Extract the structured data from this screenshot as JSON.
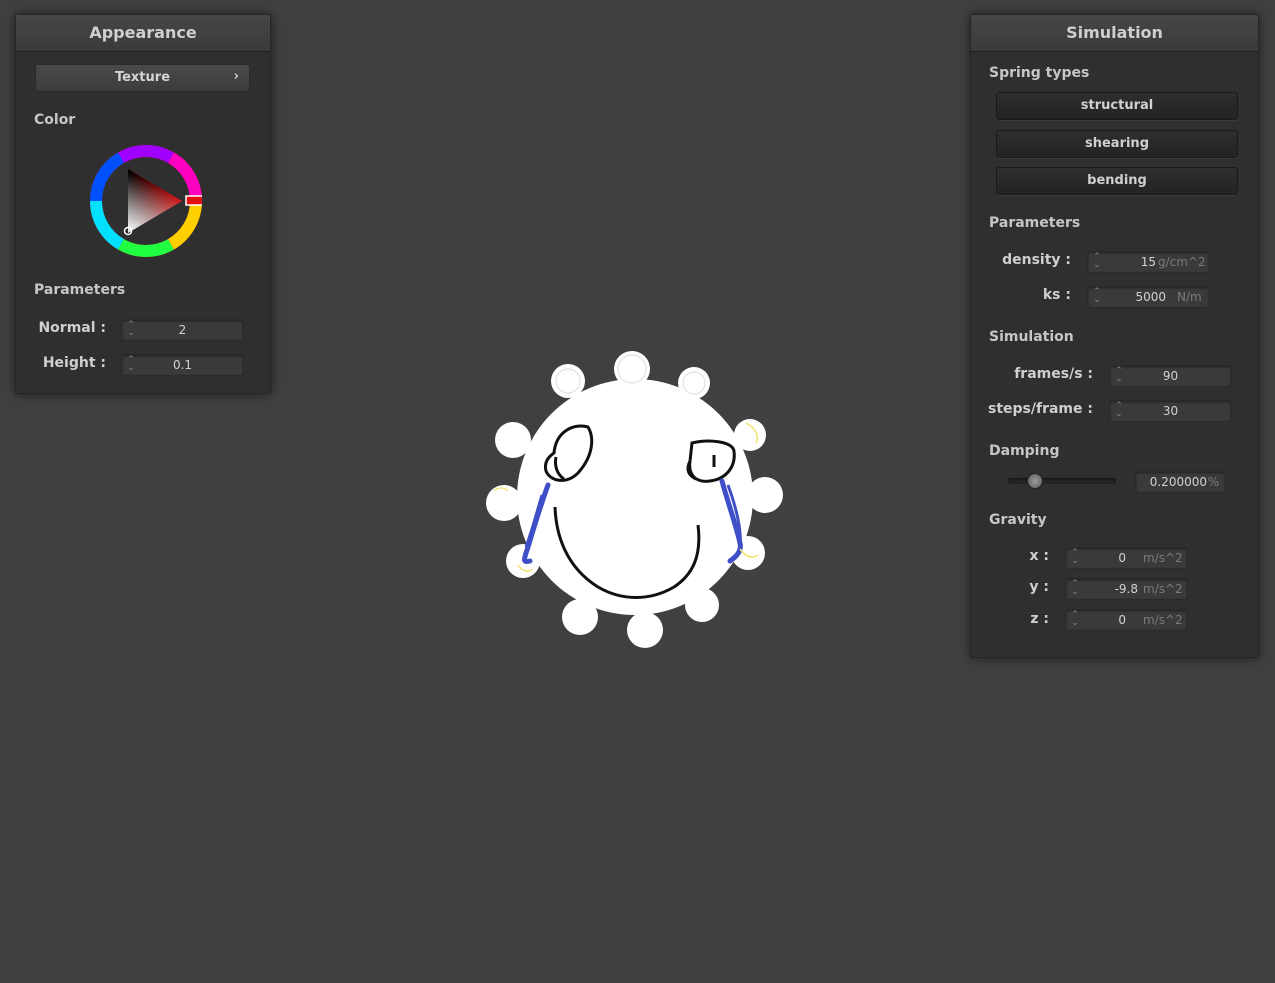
{
  "appearance": {
    "title": "Appearance",
    "texture_button": "Texture",
    "texture_chevron": "›",
    "color_label": "Color",
    "color_value": "#e01010",
    "parameters_label": "Parameters",
    "normal_label": "Normal :",
    "normal_value": "2",
    "height_label": "Height :",
    "height_value": "0.1"
  },
  "simulation": {
    "title": "Simulation",
    "spring_types_label": "Spring types",
    "spring_buttons": [
      "structural",
      "shearing",
      "bending"
    ],
    "parameters_label": "Parameters",
    "density_label": "density :",
    "density_value": "15",
    "density_unit": "g/cm^2",
    "ks_label": "ks :",
    "ks_value": "5000",
    "ks_unit": "N/m",
    "simulation_label": "Simulation",
    "frames_label": "frames/s :",
    "frames_value": "90",
    "steps_label": "steps/frame :",
    "steps_value": "30",
    "damping_label": "Damping",
    "damping_value": "0.200000",
    "damping_unit": "%",
    "damping_fraction": 0.2,
    "gravity_label": "Gravity",
    "gx_label": "x :",
    "gx_value": "0",
    "gy_label": "y :",
    "gy_value": "-9.8",
    "gz_label": "z :",
    "gz_value": "0",
    "gravity_unit": "m/s^2"
  },
  "icons": {
    "spinner": "spin-arrows-icon",
    "chevron": "chevron-right-icon"
  },
  "colors": {
    "background": "#404040",
    "panel": "#2f2f2f",
    "tear": "#3f4fc8"
  }
}
